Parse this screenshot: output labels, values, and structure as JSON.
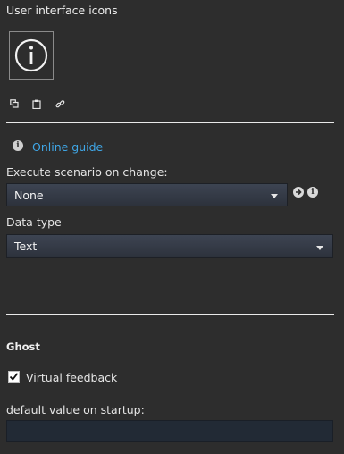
{
  "panel": {
    "section_title": "User interface icons",
    "preview_icon": "info-icon",
    "toolbar_icons": [
      "copy-icon",
      "clipboard-icon",
      "link-icon"
    ]
  },
  "guide": {
    "link_label": "Online guide",
    "icon": "info-icon"
  },
  "execute": {
    "label": "Execute scenario on change:",
    "selected": "None",
    "button_icons": [
      "arrow-right-icon",
      "info-icon"
    ]
  },
  "datatype": {
    "label": "Data type",
    "selected": "Text"
  },
  "ghost": {
    "title": "Ghost",
    "checkbox_label": "Virtual feedback",
    "checked": true
  },
  "default_value": {
    "label": "default value on startup:",
    "value": ""
  },
  "colors": {
    "background": "#2d2d2d",
    "link": "#3fa6e6",
    "select_bg": "#353b47",
    "input_bg": "#222a35",
    "divider": "#e9e9e9"
  }
}
